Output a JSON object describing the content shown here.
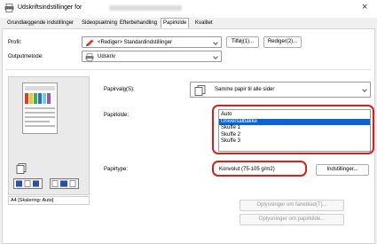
{
  "window": {
    "title": "Udskriftsindstillinger for",
    "title_blurred_suffix": "Canon Generic Plus PCL6/V4",
    "close_glyph": "×"
  },
  "tabs": [
    {
      "label": "Grundlæggende indstillinger",
      "active": false
    },
    {
      "label": "Sideopsætning",
      "active": false
    },
    {
      "label": "Efterbehandling",
      "active": false
    },
    {
      "label": "Papirkilde",
      "active": true
    },
    {
      "label": "Kvalitet",
      "active": false
    }
  ],
  "profile": {
    "label": "Profil:",
    "value": "<Rediger> Standardindstillinger",
    "settings_button": "Tilføj(1)...",
    "edit_button": "Rediger(2)..."
  },
  "output": {
    "label": "Outputmetode:",
    "value": "Udskriv"
  },
  "preview": {
    "caption": "A4 [Skalering: Auto]"
  },
  "paper_selection": {
    "label": "Papirvalg(S):",
    "value": "Samme papir til alle sider"
  },
  "paper_source": {
    "label": "Papirkilde:",
    "options": [
      "Auto",
      "Universalbakke",
      "Skuffe 1",
      "Skuffe 2",
      "Skuffe 3"
    ],
    "selected_index": 1
  },
  "paper_type": {
    "label": "Papirtype:",
    "value": "Konvolut (75-105 g/m2)",
    "settings_button": "Indstillinger..."
  },
  "bottom_buttons": {
    "cover_settings": "Oplysninger om faneblad(T)...",
    "source_info": "Oplysninger om papirkilde..."
  },
  "colors": {
    "accent": "#0a64d6",
    "highlight_ring": "#d81f1f"
  }
}
